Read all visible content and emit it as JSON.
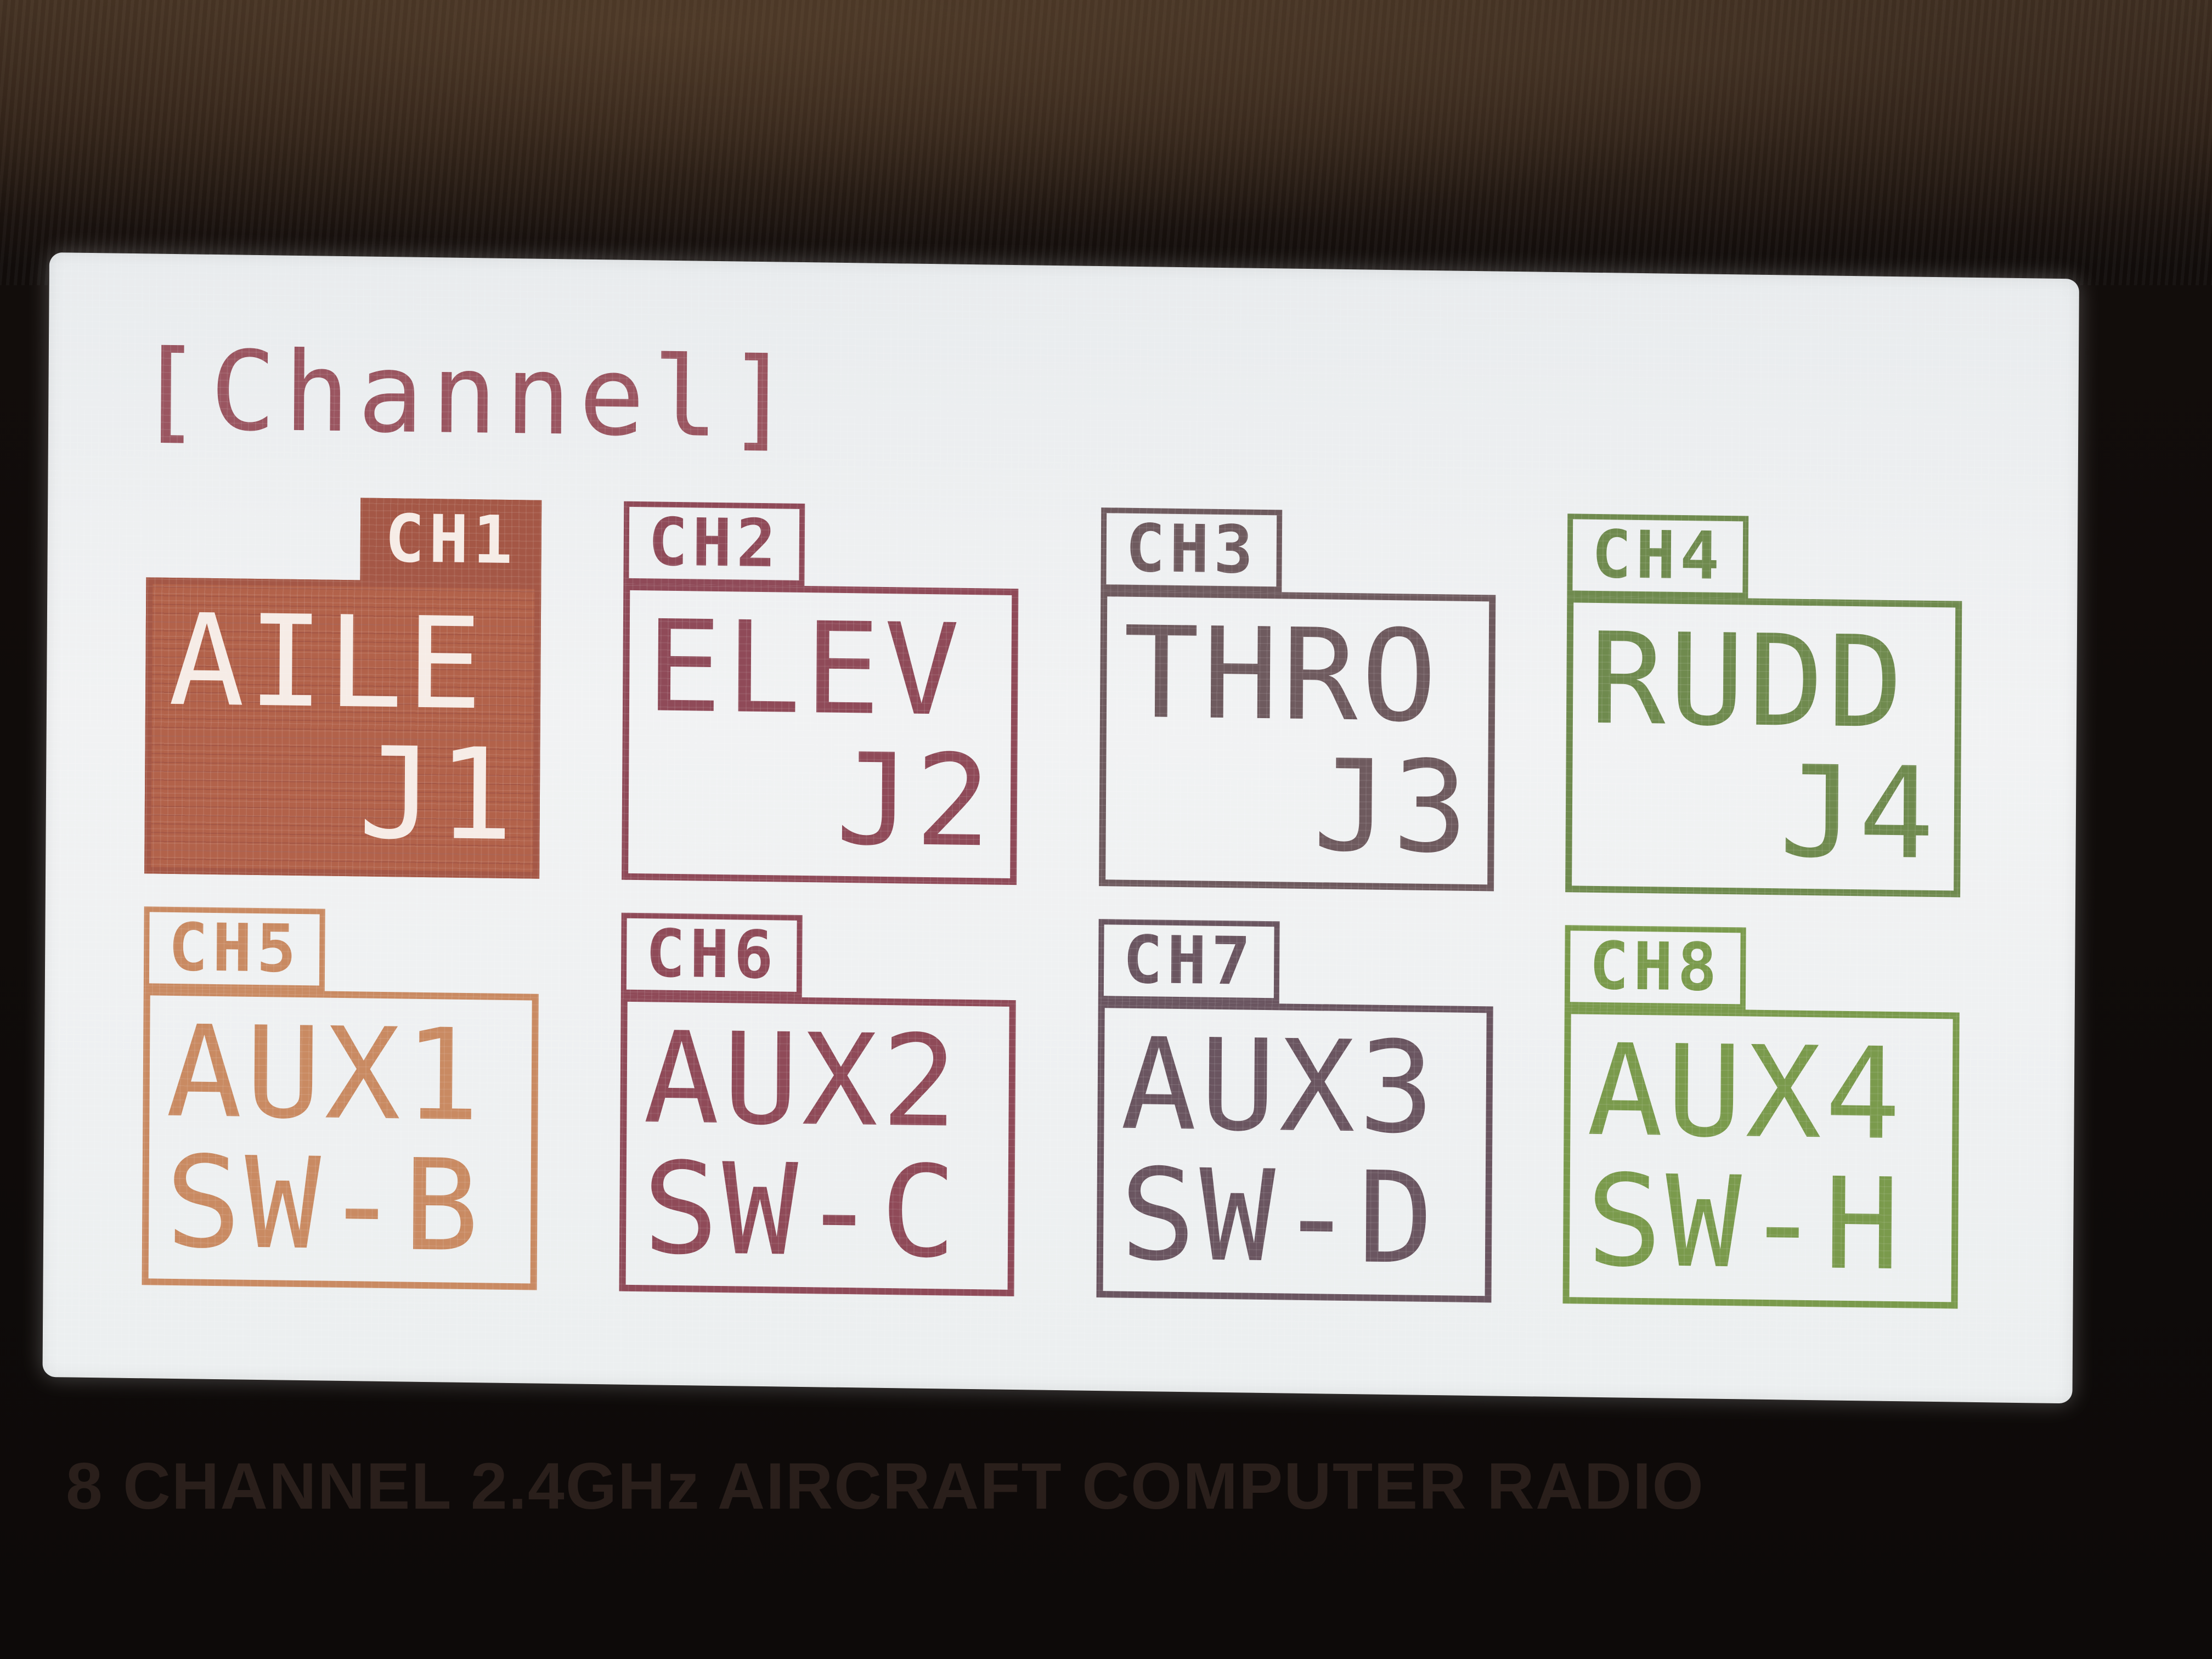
{
  "screen": {
    "title": "[Channel]"
  },
  "channels": [
    {
      "tab": "CH1",
      "function": "AILE",
      "source": "J1",
      "color": "#a45746",
      "selected": true
    },
    {
      "tab": "CH2",
      "function": "ELEV",
      "source": "J2",
      "color": "#8f4a58",
      "selected": false
    },
    {
      "tab": "CH3",
      "function": "THRO",
      "source": "J3",
      "color": "#6e5a5e",
      "selected": false
    },
    {
      "tab": "CH4",
      "function": "RUDD",
      "source": "J4",
      "color": "#6f8a4e",
      "selected": false
    },
    {
      "tab": "CH5",
      "function": "AUX1",
      "source": "SW-B",
      "color": "#c98a62",
      "selected": false
    },
    {
      "tab": "CH6",
      "function": "AUX2",
      "source": "SW-C",
      "color": "#8f4a58",
      "selected": false
    },
    {
      "tab": "CH7",
      "function": "AUX3",
      "source": "SW-D",
      "color": "#6a5560",
      "selected": false
    },
    {
      "tab": "CH8",
      "function": "AUX4",
      "source": "SW-H",
      "color": "#7a9a4c",
      "selected": false
    }
  ],
  "device": {
    "caption": "8 CHANNEL 2.4GHz AIRCRAFT COMPUTER RADIO"
  }
}
